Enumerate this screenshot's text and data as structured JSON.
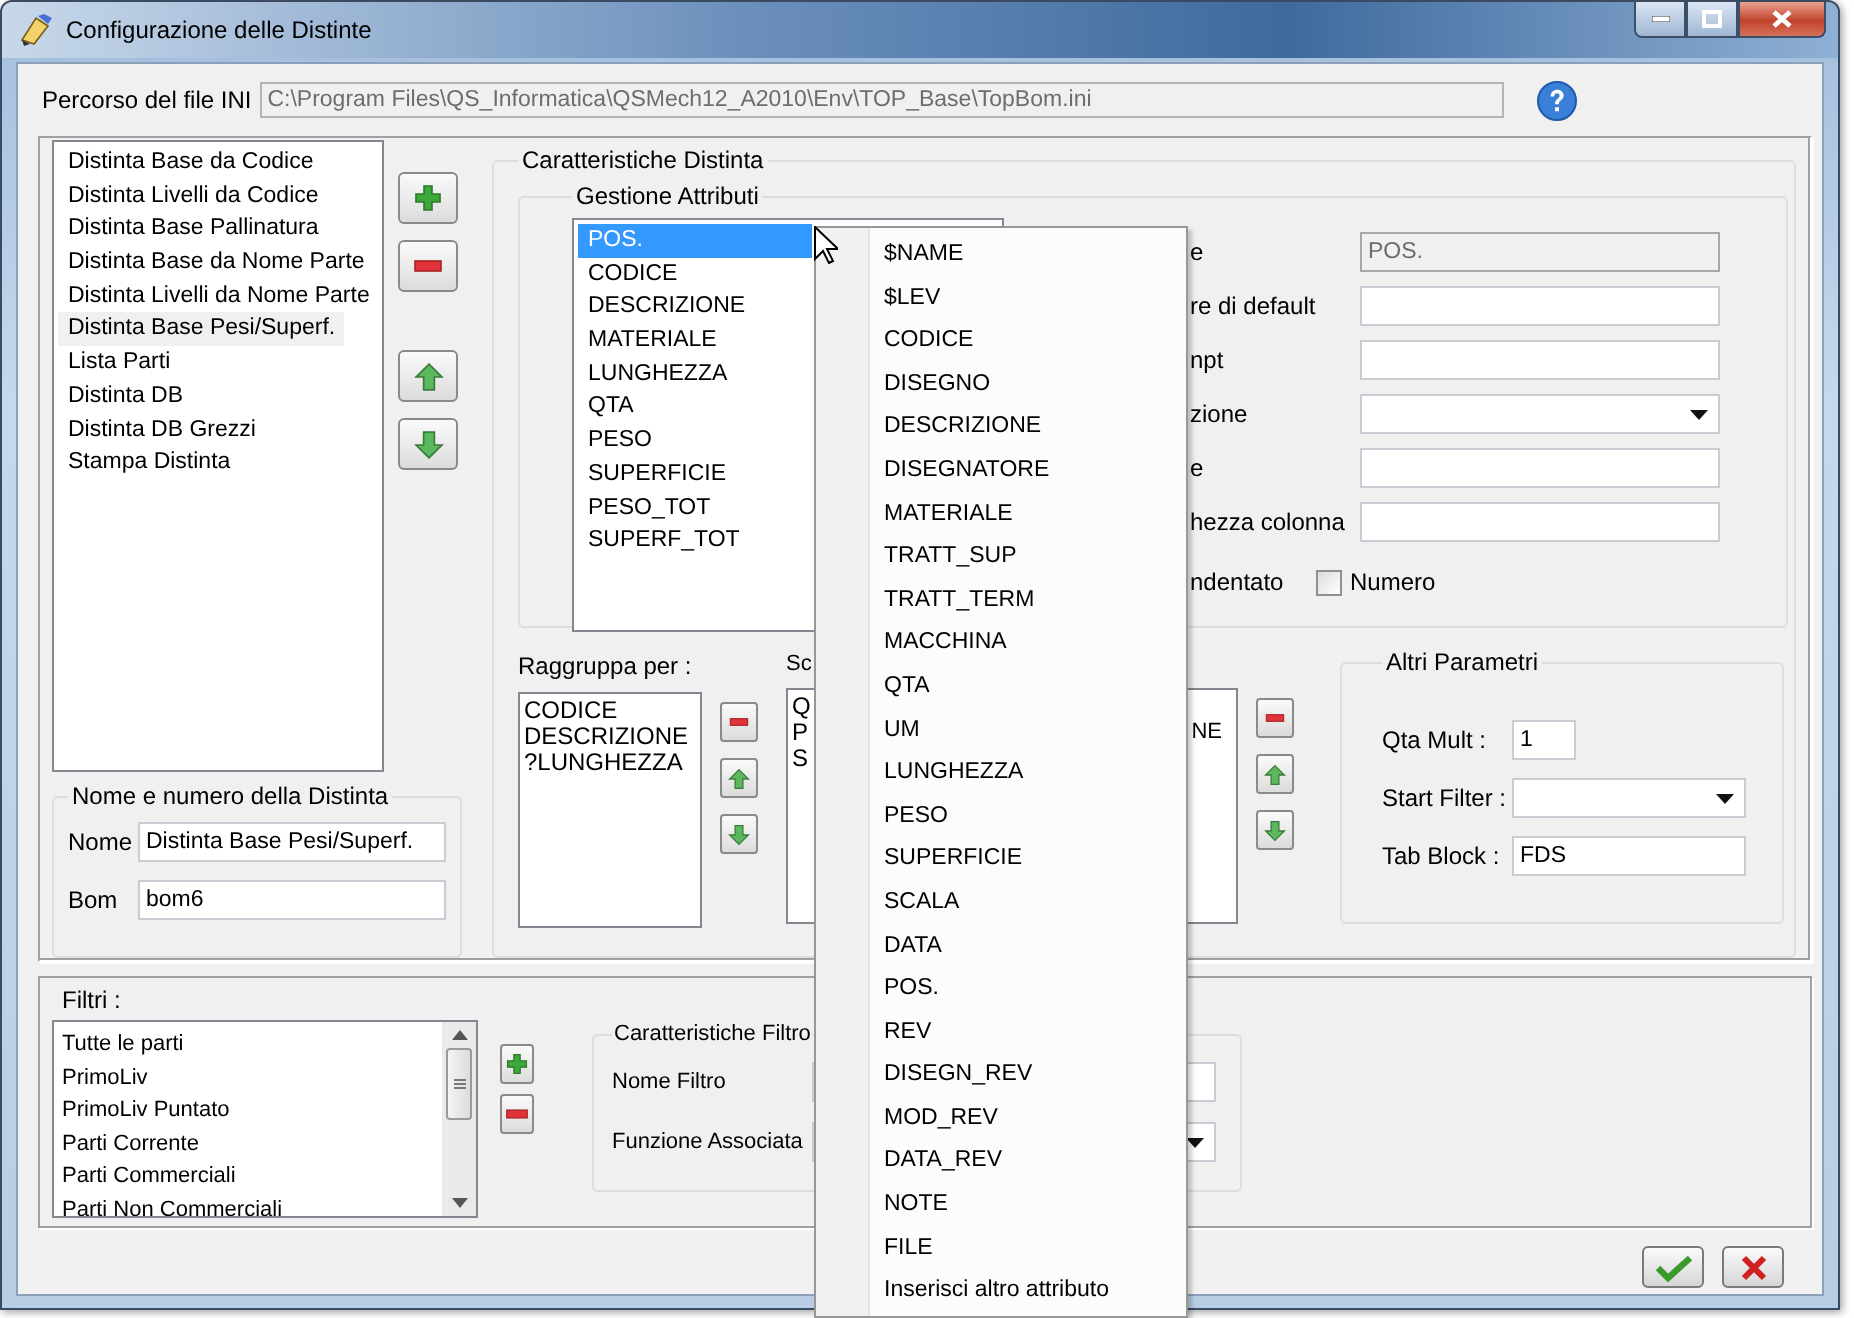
{
  "window": {
    "title": "Configurazione delle Distinte"
  },
  "ini_path": {
    "label": "Percorso del file INI",
    "value": "C:\\Program Files\\QS_Informatica\\QSMech12_A2010\\Env\\TOP_Base\\TopBom.ini"
  },
  "distinte": {
    "items": [
      {
        "label": "Distinta Base da Codice",
        "selected": false
      },
      {
        "label": "Distinta Livelli da Codice",
        "selected": false
      },
      {
        "label": "Distinta Base Pallinatura",
        "selected": false
      },
      {
        "label": "Distinta Base da Nome Parte",
        "selected": false
      },
      {
        "label": "Distinta Livelli da Nome Parte",
        "selected": false
      },
      {
        "label": "Distinta Base Pesi/Superf.",
        "selected": true
      },
      {
        "label": "Lista Parti",
        "selected": false
      },
      {
        "label": "Distinta DB",
        "selected": false
      },
      {
        "label": "Distinta DB Grezzi",
        "selected": false
      },
      {
        "label": "Stampa Distinta",
        "selected": false
      }
    ]
  },
  "name_group": {
    "title": "Nome e numero della Distinta",
    "fields": [
      {
        "label": "Nome",
        "value": "Distinta Base Pesi/Superf."
      },
      {
        "label": "Bom",
        "value": "bom6"
      }
    ]
  },
  "caratteristiche": {
    "title": "Caratteristiche Distinta",
    "attributes": {
      "title": "Gestione Attributi",
      "items": [
        {
          "label": "POS.",
          "selected": true
        },
        {
          "label": "CODICE",
          "selected": false
        },
        {
          "label": "DESCRIZIONE",
          "selected": false
        },
        {
          "label": "MATERIALE",
          "selected": false
        },
        {
          "label": "LUNGHEZZA",
          "selected": false
        },
        {
          "label": "QTA",
          "selected": false
        },
        {
          "label": "PESO",
          "selected": false
        },
        {
          "label": "SUPERFICIE",
          "selected": false
        },
        {
          "label": "PESO_TOT",
          "selected": false
        },
        {
          "label": "SUPERF_TOT",
          "selected": false
        }
      ]
    },
    "form": [
      {
        "label": "e",
        "kind": "readonly",
        "value": "POS."
      },
      {
        "label": "re di default",
        "kind": "text"
      },
      {
        "label": "npt",
        "kind": "text"
      },
      {
        "label": "zione",
        "kind": "dropdown"
      },
      {
        "label": "e",
        "kind": "text"
      },
      {
        "label": "hezza colonna",
        "kind": "text"
      }
    ],
    "indent_label": "ndentato",
    "numero": {
      "label": "Numero",
      "checked": false
    },
    "group_by": {
      "label": "Raggruppa per :",
      "items": [
        "CODICE",
        "DESCRIZIONE",
        "?LUNGHEZZA"
      ]
    },
    "sort_by": {
      "label": "Sc",
      "rows": [
        {
          "text": "Q"
        },
        {
          "text": "P",
          "tail": "NE"
        },
        {
          "text": "S"
        }
      ]
    },
    "altri": {
      "title": "Altri Parametri",
      "fields": [
        {
          "label": "Qta Mult :",
          "kind": "short",
          "value": "1"
        },
        {
          "label": "Start Filter :",
          "kind": "dropdown"
        },
        {
          "label": "Tab Block :",
          "kind": "text",
          "value": "FDS"
        }
      ]
    }
  },
  "filtri": {
    "title": "Filtri :",
    "items": [
      {
        "label": "Tutte le parti",
        "selected": false
      },
      {
        "label": "PrimoLiv",
        "selected": false
      },
      {
        "label": "PrimoLiv Puntato",
        "selected": false
      },
      {
        "label": "Parti Corrente",
        "selected": false
      },
      {
        "label": "Parti Commerciali",
        "selected": false
      },
      {
        "label": "Parti Non Commerciali",
        "selected": false
      }
    ],
    "filter_group": {
      "title": "Caratteristiche Filtro",
      "fields": [
        {
          "label": "Nome Filtro",
          "kind": "text"
        },
        {
          "label": "Funzione Associata",
          "kind": "dropdown"
        }
      ]
    }
  },
  "context_menu": {
    "items": [
      "$NAME",
      "$LEV",
      "CODICE",
      "DISEGNO",
      "DESCRIZIONE",
      "DISEGNATORE",
      "MATERIALE",
      "TRATT_SUP",
      "TRATT_TERM",
      "MACCHINA",
      "QTA",
      "UM",
      "LUNGHEZZA",
      "PESO",
      "SUPERFICIE",
      "SCALA",
      "DATA",
      "POS.",
      "REV",
      "DISEGN_REV",
      "MOD_REV",
      "DATA_REV",
      "NOTE",
      "FILE",
      "Inserisci altro attributo"
    ]
  }
}
